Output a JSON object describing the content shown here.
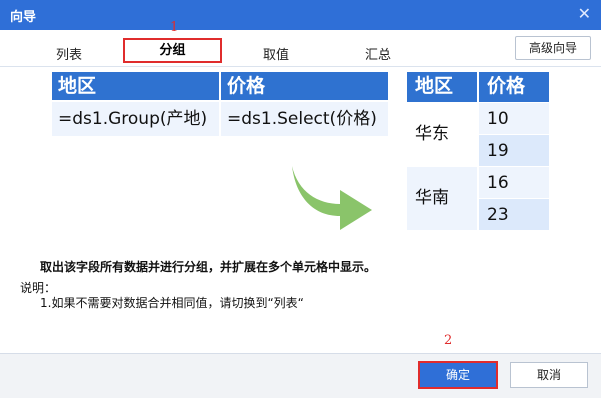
{
  "window": {
    "title": "向导"
  },
  "tabs": [
    "列表",
    "分组",
    "取值",
    "汇总"
  ],
  "advanced_label": "高级向导",
  "annotations": {
    "one": "1",
    "two": "2"
  },
  "source_table": {
    "headers": [
      "地区",
      "价格"
    ],
    "formulas": [
      "=ds1.Group(产地)",
      "=ds1.Select(价格)"
    ]
  },
  "result_table": {
    "headers": [
      "地区",
      "价格"
    ],
    "groups": [
      {
        "region": "华东",
        "values": [
          "10",
          "19"
        ]
      },
      {
        "region": "华南",
        "values": [
          "16",
          "23"
        ]
      }
    ]
  },
  "description": {
    "main": "取出该字段所有数据并进行分组，并扩展在多个单元格中显示。",
    "note_label": "说明：",
    "note_item": "1.如果不需要对数据合并相同值，请切换到“列表“"
  },
  "buttons": {
    "ok": "确定",
    "cancel": "取消"
  },
  "colors": {
    "accent": "#2f72d0",
    "highlight": "#e02c2c",
    "arrow": "#8ac46a",
    "light_cell": "#e4efff"
  }
}
